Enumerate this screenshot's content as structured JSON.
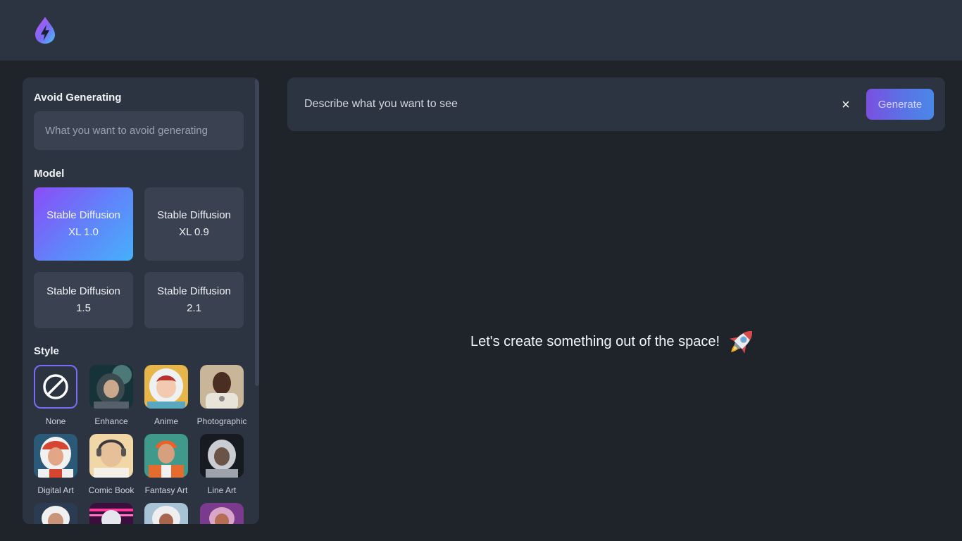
{
  "header": {
    "logo_icon": "lightning-drop-logo-icon",
    "accent_colors": [
      "#a24cf5",
      "#4fc3f7"
    ]
  },
  "sidebar": {
    "avoid": {
      "title": "Avoid Generating",
      "placeholder": "What you want to avoid generating",
      "value": ""
    },
    "model": {
      "title": "Model",
      "options": [
        {
          "label": "Stable Diffusion XL 1.0",
          "selected": true
        },
        {
          "label": "Stable Diffusion XL 0.9",
          "selected": false
        },
        {
          "label": "Stable Diffusion 1.5",
          "selected": false
        },
        {
          "label": "Stable Diffusion 2.1",
          "selected": false
        }
      ],
      "selected_gradient": [
        "#8b4cf7",
        "#46b0fb"
      ]
    },
    "style": {
      "title": "Style",
      "items": [
        {
          "label": "None",
          "icon": "ban-icon",
          "selected": true
        },
        {
          "label": "Enhance",
          "icon": "astronaut-enhance-thumbnail"
        },
        {
          "label": "Anime",
          "icon": "astronaut-anime-thumbnail"
        },
        {
          "label": "Photographic",
          "icon": "astronaut-photographic-thumbnail"
        },
        {
          "label": "Digital Art",
          "icon": "astronaut-digital-art-thumbnail"
        },
        {
          "label": "Comic Book",
          "icon": "astronaut-comic-book-thumbnail"
        },
        {
          "label": "Fantasy Art",
          "icon": "astronaut-fantasy-art-thumbnail"
        },
        {
          "label": "Line Art",
          "icon": "astronaut-line-art-thumbnail"
        },
        {
          "label": "",
          "icon": "astronaut-thumbnail"
        },
        {
          "label": "",
          "icon": "astronaut-neon-thumbnail"
        },
        {
          "label": "",
          "icon": "astronaut-thumbnail"
        },
        {
          "label": "",
          "icon": "astronaut-thumbnail"
        }
      ]
    }
  },
  "prompt": {
    "placeholder": "Describe what you want to see",
    "value": "",
    "clear_label": "×",
    "generate_label": "Generate"
  },
  "main": {
    "empty_message": "Let's create something out of the space!",
    "empty_icon": "rocket-icon"
  }
}
